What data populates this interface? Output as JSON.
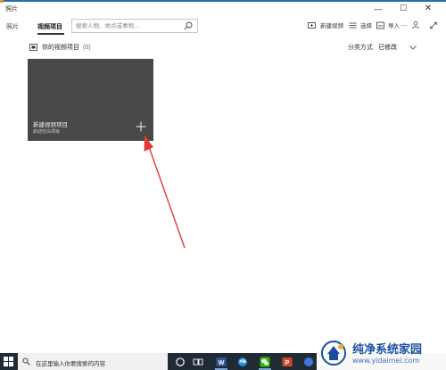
{
  "window": {
    "title": "照片",
    "minimize_glyph": "—",
    "maximize_glyph": "☐",
    "close_glyph": "✕"
  },
  "nav": {
    "photos_tab": "照片",
    "video_projects_tab": "视频项目",
    "active_tab": "视频项目"
  },
  "search": {
    "placeholder": "搜索人物、地点或事物..."
  },
  "toolbar": {
    "new_video_label": "新建视频",
    "select_label": "选择",
    "import_label": "导入",
    "more_glyph": "···"
  },
  "projects": {
    "header": "你的视频项目",
    "count": "(0)",
    "sort_label": "分类方式",
    "sort_value": "已修改",
    "new_tile": {
      "title": "新建视频项目",
      "subtitle": "启动空白项目"
    }
  },
  "taskbar": {
    "search_text": "在这里输入你要搜索的内容",
    "pinned_icons": [
      "cortana-icon",
      "task-view-icon",
      "word-icon",
      "edge-icon",
      "wechat-icon",
      "powerpoint-icon",
      "app-icon",
      "photos-icon"
    ]
  },
  "watermark": {
    "site_name": "纯净系统家园",
    "url": "www.yidaimei.com"
  },
  "colors": {
    "tile_bg": "#4a4948",
    "taskbar_bg": "#202b36",
    "accent": "#2b6cb0",
    "annotation_arrow": "#e53935"
  }
}
